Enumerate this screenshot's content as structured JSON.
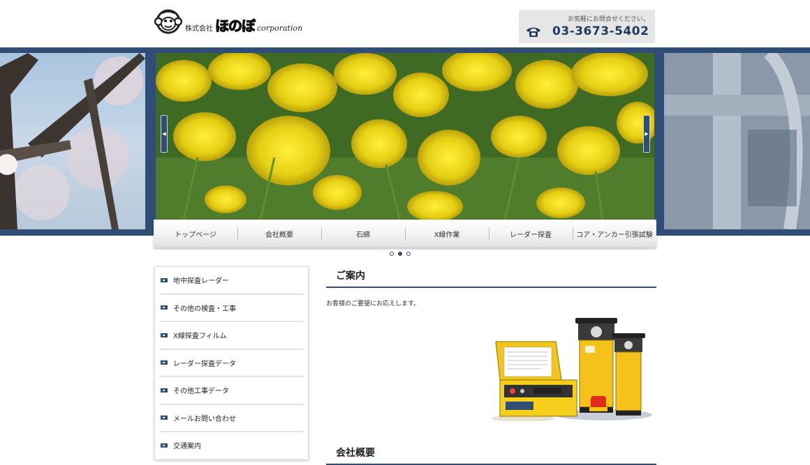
{
  "header": {
    "logo_small": "株式会社",
    "logo_brand": "ほのぼ",
    "logo_corp": "corporation",
    "phone_note": "お気軽にお問合せください。",
    "phone_number": "03-3673-5402"
  },
  "nav": {
    "items": [
      "トップページ",
      "会社概要",
      "石綿",
      "X線作業",
      "レーダー探査",
      "コア・アンカー引張試験"
    ]
  },
  "slider": {
    "dot_count": 3,
    "active_dot": 2
  },
  "sidebar": {
    "items": [
      "地中探査レーダー",
      "その他の検査・工事",
      "X線探査フィルム",
      "レーダー探査データ",
      "その他工事データ",
      "メールお問い合わせ",
      "交通案内"
    ]
  },
  "main": {
    "section1_title": "ご案内",
    "intro": "お客様のご要望にお応えします。",
    "section2_title": "会社概要"
  },
  "colors": {
    "accent": "#2f4d75",
    "phone_text": "#1f3a5f"
  }
}
